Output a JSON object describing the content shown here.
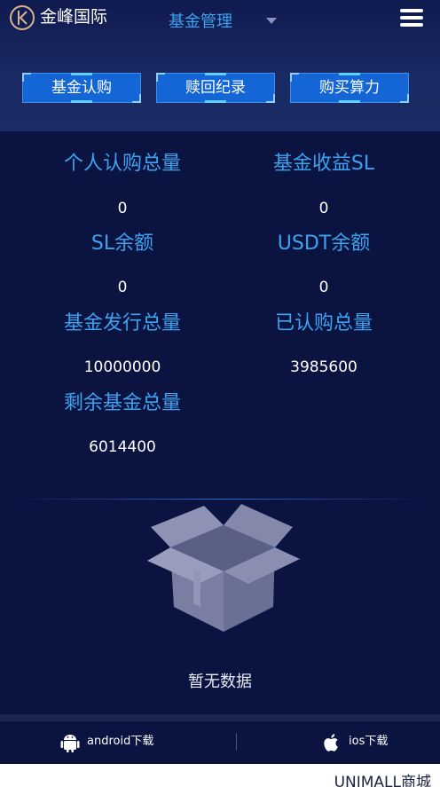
{
  "header": {
    "brand": "金峰国际",
    "nav_select": "基金管理",
    "logo_icon": "k-circle-logo",
    "menu_icon": "hamburger-icon"
  },
  "tabs": [
    {
      "label": "基金认购"
    },
    {
      "label": "赎回纪录"
    },
    {
      "label": "购买算力"
    }
  ],
  "stats": [
    {
      "label": "个人认购总量",
      "value": "0"
    },
    {
      "label": "基金收益SL",
      "value": "0"
    },
    {
      "label": "SL余额",
      "value": "0"
    },
    {
      "label": "USDT余额",
      "value": "0"
    },
    {
      "label": "基金发行总量",
      "value": "10000000"
    },
    {
      "label": "已认购总量",
      "value": "3985600"
    },
    {
      "label": "剩余基金总量",
      "value": "6014400"
    }
  ],
  "empty": {
    "icon": "open-box-icon",
    "text": "暂无数据"
  },
  "footer": {
    "android_label": "android下载",
    "ios_label": "ios下载",
    "mall": "UNIMALL商城"
  },
  "colors": {
    "background": "#0b1340",
    "accent": "#3ba3f0",
    "tab": "#1466d6"
  }
}
